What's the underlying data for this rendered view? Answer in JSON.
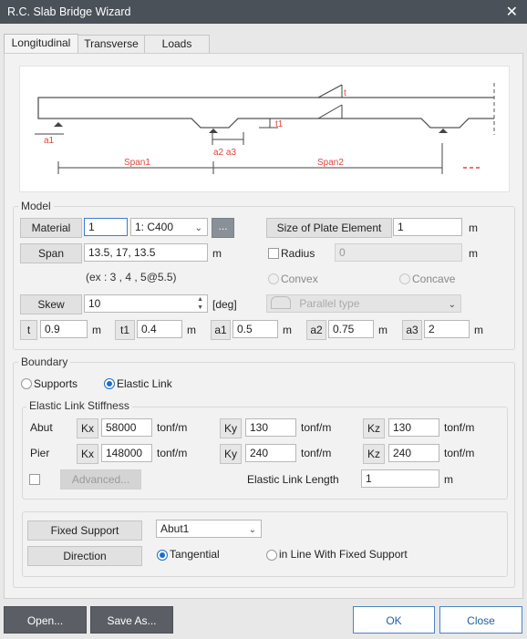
{
  "window": {
    "title": "R.C. Slab Bridge Wizard"
  },
  "tabs": [
    "Longitudinal",
    "Transverse",
    "Loads"
  ],
  "diagram": {
    "labels": {
      "t": "t",
      "t1": "t1",
      "a1": "a1",
      "a2a3": "a2 a3",
      "span1": "Span1",
      "span2": "Span2"
    }
  },
  "model": {
    "title": "Model",
    "material_btn": "Material",
    "material_id": "1",
    "material_select": "1: C400",
    "ellipsis": "...",
    "plate_btn": "Size of Plate Element",
    "plate_value": "1",
    "plate_unit": "m",
    "span_btn": "Span",
    "span_value": "13.5, 17, 13.5",
    "span_unit": "m",
    "radius_label": "Radius",
    "radius_value": "0",
    "radius_unit": "m",
    "span_hint": "(ex : 3 , 4 , 5@5.5)",
    "convex": "Convex",
    "concave": "Concave",
    "skew_btn": "Skew",
    "skew_value": "10",
    "skew_unit": "[deg]",
    "parallel_type": "Parallel type",
    "params": [
      {
        "name": "t",
        "value": "0.9",
        "unit": "m"
      },
      {
        "name": "t1",
        "value": "0.4",
        "unit": "m"
      },
      {
        "name": "a1",
        "value": "0.5",
        "unit": "m"
      },
      {
        "name": "a2",
        "value": "0.75",
        "unit": "m"
      },
      {
        "name": "a3",
        "value": "2",
        "unit": "m"
      }
    ]
  },
  "boundary": {
    "title": "Boundary",
    "supports": "Supports",
    "elastic_link": "Elastic Link",
    "stiffness_title": "Elastic Link Stiffness",
    "abut_label": "Abut",
    "pier_label": "Pier",
    "kx": "Kx",
    "ky": "Ky",
    "kz": "Kz",
    "unit": "tonf/m",
    "abut": {
      "kx": "58000",
      "ky": "130",
      "kz": "130"
    },
    "pier": {
      "kx": "148000",
      "ky": "240",
      "kz": "240"
    },
    "advanced_btn": "Advanced...",
    "link_length_label": "Elastic Link Length",
    "link_length_value": "1",
    "link_length_unit": "m",
    "fixed_support_btn": "Fixed Support",
    "fixed_support_value": "Abut1",
    "direction_btn": "Direction",
    "tangential": "Tangential",
    "in_line": "in Line With Fixed Support"
  },
  "footer": {
    "open": "Open...",
    "save_as": "Save As...",
    "ok": "OK",
    "close": "Close"
  }
}
